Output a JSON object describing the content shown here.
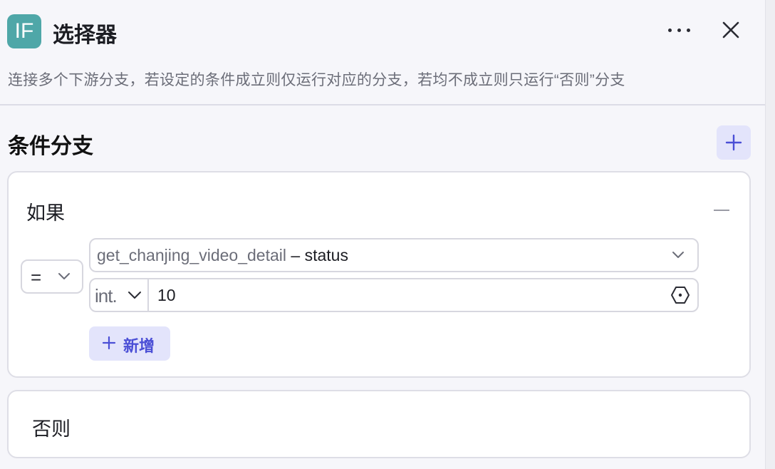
{
  "header": {
    "icon_text": "IF",
    "title": "选择器",
    "description": "连接多个下游分支，若设定的条件成立则仅运行对应的分支，若均不成立则只运行“否则”分支",
    "more_icon": "more-horizontal-icon",
    "close_icon": "close-icon"
  },
  "section": {
    "title": "条件分支",
    "add_icon": "plus-icon"
  },
  "if_branch": {
    "label": "如果",
    "collapse_icon": "minus-icon",
    "operator": "=",
    "variable_node": "get_chanjing_video_detail",
    "variable_separator": " – ",
    "variable_field": "status",
    "value_type": "int.",
    "value": "10",
    "add_condition_label": "新增"
  },
  "else_branch": {
    "label": "否则"
  },
  "colors": {
    "accent": "#4b4fd6",
    "accent_bg": "#e3e4fb",
    "icon_bg": "#4fa7a8"
  }
}
